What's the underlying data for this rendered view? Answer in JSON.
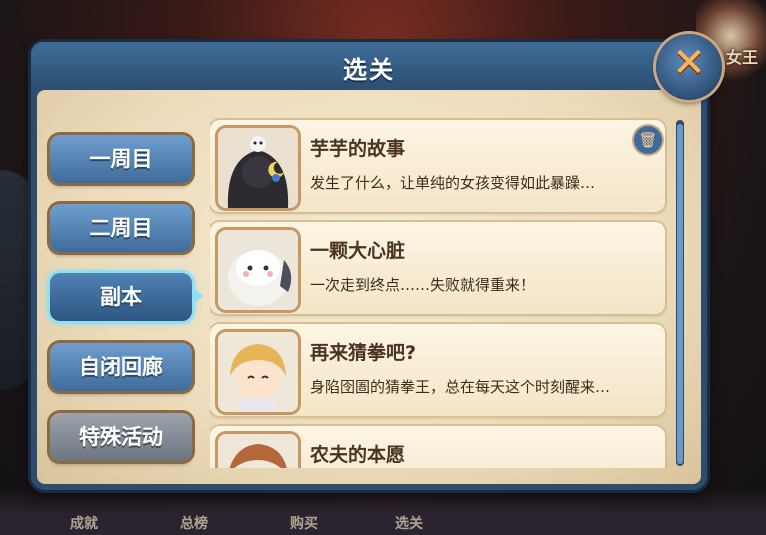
{
  "dialog": {
    "title": "选关"
  },
  "background": {
    "corner_label": "女王",
    "bottom_labels": [
      "成就",
      "总榜",
      "购买",
      "选关"
    ]
  },
  "sidebar": {
    "items": [
      {
        "label": "一周目",
        "state": "normal"
      },
      {
        "label": "二周目",
        "state": "normal"
      },
      {
        "label": "副本",
        "state": "selected"
      },
      {
        "label": "自闭回廊",
        "state": "normal"
      },
      {
        "label": "特殊活动",
        "state": "gray"
      }
    ]
  },
  "levels": [
    {
      "title": "芋芋的故事",
      "desc": "发生了什么，让单纯的女孩变得如此暴躁…"
    },
    {
      "title": "一颗大心脏",
      "desc": "一次走到终点……失败就得重来！"
    },
    {
      "title": "再来猜拳吧?",
      "desc": "身陷囹圄的猜拳王，总在每天这个时刻醒来…"
    },
    {
      "title": "农夫的本愿",
      "desc": ""
    }
  ],
  "icons": {
    "close": "close-icon",
    "trash": "trash-icon",
    "selected_arrow": "arrow-right-icon"
  },
  "colors": {
    "accent": "#3f6c97",
    "close_x": "#ffb25a",
    "selected_glow": "#8ee0f2"
  }
}
